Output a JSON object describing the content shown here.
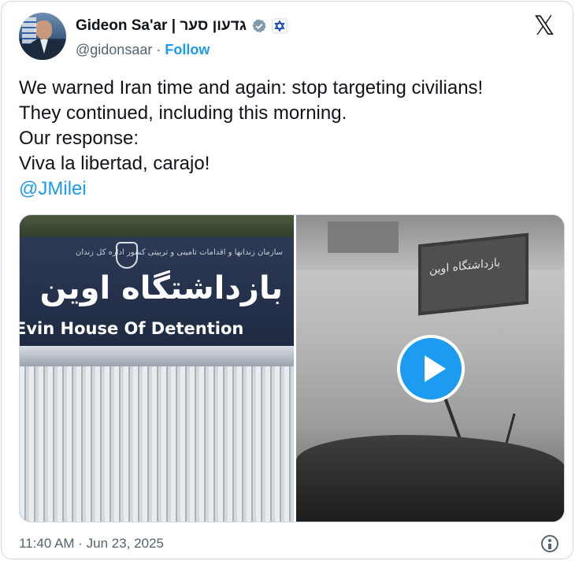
{
  "author": {
    "name": "Gideon Sa'ar | גדעון סער",
    "handle": "@gidonsaar",
    "separator": "·",
    "follow_label": "Follow",
    "verified_icon": "verified-badge-icon",
    "affiliation_icon": "government-affiliation-icon"
  },
  "platform_logo": "𝕏",
  "tweet": {
    "lines": [
      "We warned Iran time and again: stop targeting civilians!",
      "They continued, including this morning.",
      "Our response:",
      "Viva la libertad, carajo!"
    ],
    "mention": "@JMilei"
  },
  "media": {
    "left_image": {
      "sign_farsi_small": "سازمان زندانها و اقدامات تامینی و تربیتی کشور  اداره کل زندان",
      "sign_farsi_big": "بازداشتگاه اوین",
      "sign_english": "Evin House Of Detention"
    },
    "right_image": {
      "sign_text": "بازداشتگاه اوین",
      "play_icon": "play-button-icon"
    }
  },
  "footer": {
    "timestamp": "11:40 AM · Jun 23, 2025",
    "info_icon": "info-icon"
  },
  "colors": {
    "accent": "#1d9bf0",
    "text": "#0f1419",
    "muted": "#536471",
    "border": "#cfd9de"
  }
}
